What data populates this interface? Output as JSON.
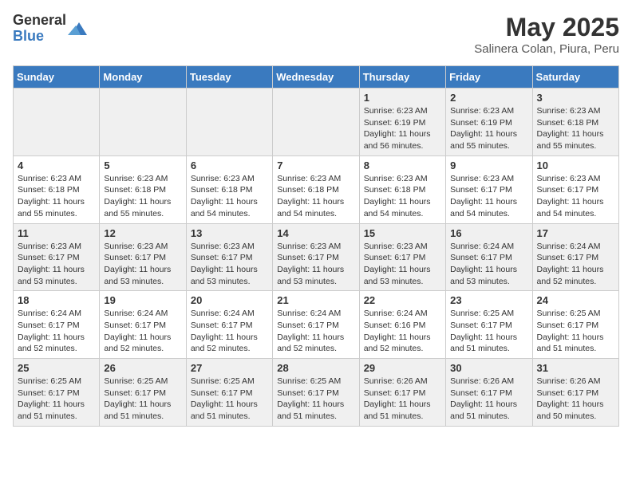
{
  "logo": {
    "general": "General",
    "blue": "Blue"
  },
  "header": {
    "title": "May 2025",
    "subtitle": "Salinera Colan, Piura, Peru"
  },
  "weekdays": [
    "Sunday",
    "Monday",
    "Tuesday",
    "Wednesday",
    "Thursday",
    "Friday",
    "Saturday"
  ],
  "weeks": [
    [
      {
        "day": "",
        "info": ""
      },
      {
        "day": "",
        "info": ""
      },
      {
        "day": "",
        "info": ""
      },
      {
        "day": "",
        "info": ""
      },
      {
        "day": "1",
        "info": "Sunrise: 6:23 AM\nSunset: 6:19 PM\nDaylight: 11 hours\nand 56 minutes."
      },
      {
        "day": "2",
        "info": "Sunrise: 6:23 AM\nSunset: 6:19 PM\nDaylight: 11 hours\nand 55 minutes."
      },
      {
        "day": "3",
        "info": "Sunrise: 6:23 AM\nSunset: 6:18 PM\nDaylight: 11 hours\nand 55 minutes."
      }
    ],
    [
      {
        "day": "4",
        "info": "Sunrise: 6:23 AM\nSunset: 6:18 PM\nDaylight: 11 hours\nand 55 minutes."
      },
      {
        "day": "5",
        "info": "Sunrise: 6:23 AM\nSunset: 6:18 PM\nDaylight: 11 hours\nand 55 minutes."
      },
      {
        "day": "6",
        "info": "Sunrise: 6:23 AM\nSunset: 6:18 PM\nDaylight: 11 hours\nand 54 minutes."
      },
      {
        "day": "7",
        "info": "Sunrise: 6:23 AM\nSunset: 6:18 PM\nDaylight: 11 hours\nand 54 minutes."
      },
      {
        "day": "8",
        "info": "Sunrise: 6:23 AM\nSunset: 6:18 PM\nDaylight: 11 hours\nand 54 minutes."
      },
      {
        "day": "9",
        "info": "Sunrise: 6:23 AM\nSunset: 6:17 PM\nDaylight: 11 hours\nand 54 minutes."
      },
      {
        "day": "10",
        "info": "Sunrise: 6:23 AM\nSunset: 6:17 PM\nDaylight: 11 hours\nand 54 minutes."
      }
    ],
    [
      {
        "day": "11",
        "info": "Sunrise: 6:23 AM\nSunset: 6:17 PM\nDaylight: 11 hours\nand 53 minutes."
      },
      {
        "day": "12",
        "info": "Sunrise: 6:23 AM\nSunset: 6:17 PM\nDaylight: 11 hours\nand 53 minutes."
      },
      {
        "day": "13",
        "info": "Sunrise: 6:23 AM\nSunset: 6:17 PM\nDaylight: 11 hours\nand 53 minutes."
      },
      {
        "day": "14",
        "info": "Sunrise: 6:23 AM\nSunset: 6:17 PM\nDaylight: 11 hours\nand 53 minutes."
      },
      {
        "day": "15",
        "info": "Sunrise: 6:23 AM\nSunset: 6:17 PM\nDaylight: 11 hours\nand 53 minutes."
      },
      {
        "day": "16",
        "info": "Sunrise: 6:24 AM\nSunset: 6:17 PM\nDaylight: 11 hours\nand 53 minutes."
      },
      {
        "day": "17",
        "info": "Sunrise: 6:24 AM\nSunset: 6:17 PM\nDaylight: 11 hours\nand 52 minutes."
      }
    ],
    [
      {
        "day": "18",
        "info": "Sunrise: 6:24 AM\nSunset: 6:17 PM\nDaylight: 11 hours\nand 52 minutes."
      },
      {
        "day": "19",
        "info": "Sunrise: 6:24 AM\nSunset: 6:17 PM\nDaylight: 11 hours\nand 52 minutes."
      },
      {
        "day": "20",
        "info": "Sunrise: 6:24 AM\nSunset: 6:17 PM\nDaylight: 11 hours\nand 52 minutes."
      },
      {
        "day": "21",
        "info": "Sunrise: 6:24 AM\nSunset: 6:17 PM\nDaylight: 11 hours\nand 52 minutes."
      },
      {
        "day": "22",
        "info": "Sunrise: 6:24 AM\nSunset: 6:16 PM\nDaylight: 11 hours\nand 52 minutes."
      },
      {
        "day": "23",
        "info": "Sunrise: 6:25 AM\nSunset: 6:17 PM\nDaylight: 11 hours\nand 51 minutes."
      },
      {
        "day": "24",
        "info": "Sunrise: 6:25 AM\nSunset: 6:17 PM\nDaylight: 11 hours\nand 51 minutes."
      }
    ],
    [
      {
        "day": "25",
        "info": "Sunrise: 6:25 AM\nSunset: 6:17 PM\nDaylight: 11 hours\nand 51 minutes."
      },
      {
        "day": "26",
        "info": "Sunrise: 6:25 AM\nSunset: 6:17 PM\nDaylight: 11 hours\nand 51 minutes."
      },
      {
        "day": "27",
        "info": "Sunrise: 6:25 AM\nSunset: 6:17 PM\nDaylight: 11 hours\nand 51 minutes."
      },
      {
        "day": "28",
        "info": "Sunrise: 6:25 AM\nSunset: 6:17 PM\nDaylight: 11 hours\nand 51 minutes."
      },
      {
        "day": "29",
        "info": "Sunrise: 6:26 AM\nSunset: 6:17 PM\nDaylight: 11 hours\nand 51 minutes."
      },
      {
        "day": "30",
        "info": "Sunrise: 6:26 AM\nSunset: 6:17 PM\nDaylight: 11 hours\nand 51 minutes."
      },
      {
        "day": "31",
        "info": "Sunrise: 6:26 AM\nSunset: 6:17 PM\nDaylight: 11 hours\nand 50 minutes."
      }
    ]
  ]
}
